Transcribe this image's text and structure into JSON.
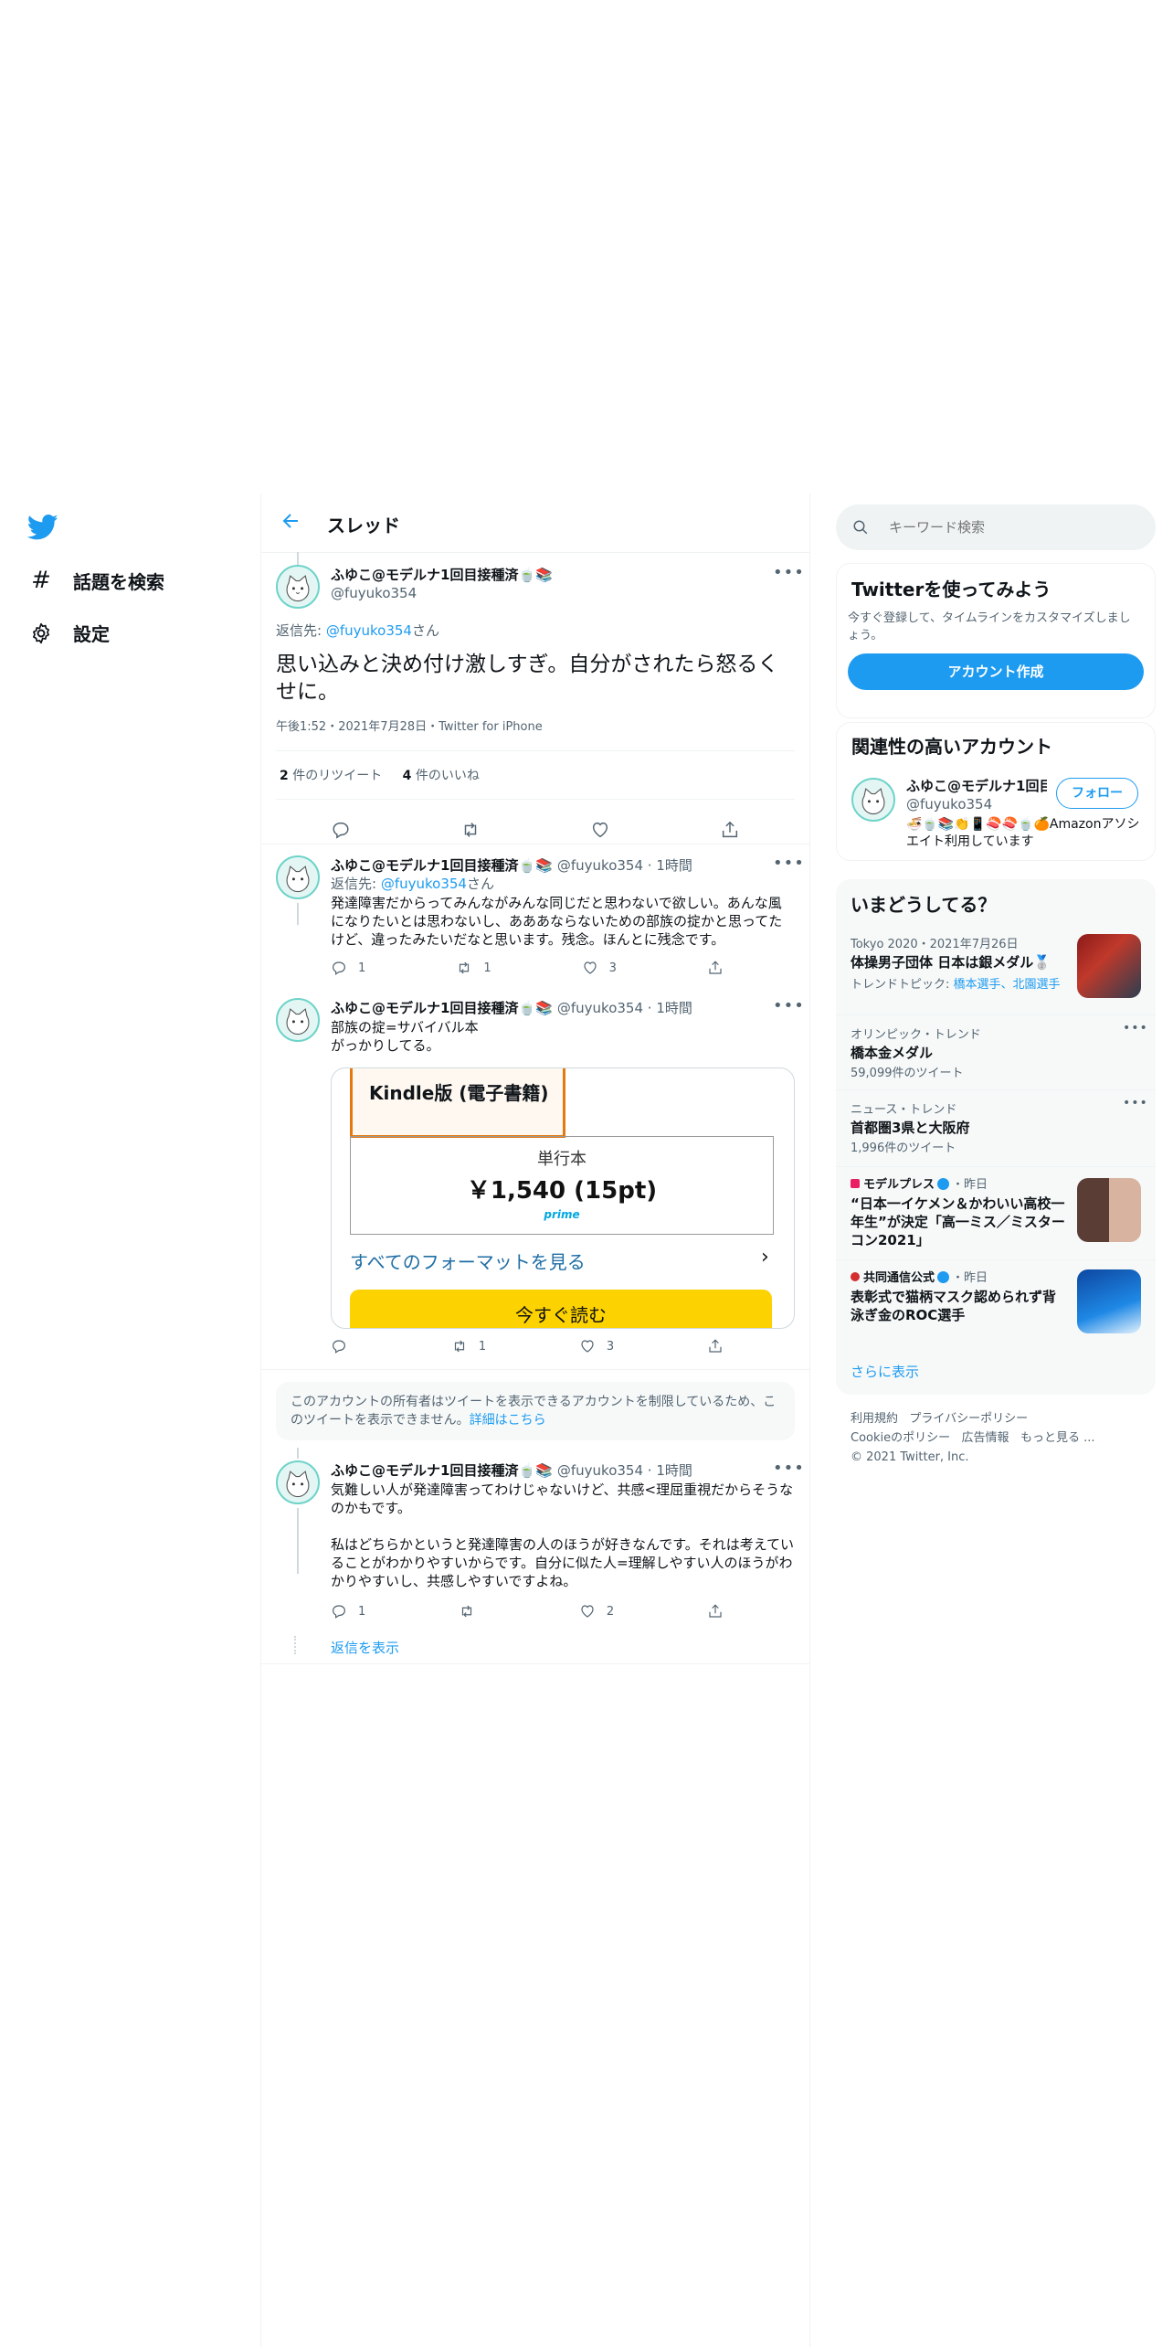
{
  "nav": {
    "explore_label": "話題を検索",
    "settings_label": "設定"
  },
  "header": {
    "title": "スレッド"
  },
  "main_tweet": {
    "name": "ふゆこ@モデルナ1回目接種済🍵📚",
    "handle": "@fuyuko354",
    "reply_prefix": "返信先: ",
    "reply_to": "@fuyuko354",
    "reply_suffix": "さん",
    "text": "思い込みと決め付け激しすぎ。自分がされたら怒るくせに。",
    "time": "午後1:52",
    "date": "2021年7月28日",
    "source": "Twitter for iPhone",
    "retweet_count": "2",
    "retweet_label": "件のリツイート",
    "like_count": "4",
    "like_label": "件のいいね"
  },
  "reply1": {
    "name": "ふゆこ@モデルナ1回目接種済🍵📚",
    "handle": "@fuyuko354",
    "time": "1時間",
    "reply_prefix": "返信先: ",
    "reply_to": "@fuyuko354",
    "reply_suffix": "さん",
    "text": "発達障害だからってみんながみんな同じだと思わないで欲しい。あんな風になりたいとは思わないし、あああならないための部族の掟かと思ってたけど、違ったみたいだなと思います。残念。ほんとに残念です。",
    "replies": "1",
    "retweets": "1",
    "likes": "3"
  },
  "reply2": {
    "name": "ふゆこ@モデルナ1回目接種済🍵📚",
    "handle": "@fuyuko354",
    "time": "1時間",
    "text_line1": "部族の掟=サバイバル本",
    "text_line2": "がっかりしてる。",
    "card": {
      "kindle_label": "Kindle版 (電子書籍)",
      "format": "単行本",
      "price": "￥1,540 (15pt)",
      "prime": "prime",
      "all_formats": "すべてのフォーマットを見る",
      "read_now": "今すぐ読む"
    },
    "replies": "",
    "retweets": "1",
    "likes": "3"
  },
  "restricted": {
    "text": "このアカウントの所有者はツイートを表示できるアカウントを制限しているため、このツイートを表示できません。",
    "link": "詳細はこちら"
  },
  "reply3": {
    "name": "ふゆこ@モデルナ1回目接種済🍵📚",
    "handle": "@fuyuko354",
    "time": "1時間",
    "text_p1": "気難しい人が発達障害ってわけじゃないけど、共感<理屈重視だからそうなのかもです。",
    "text_p2": "私はどちらかというと発達障害の人のほうが好きなんです。それは考えていることがわかりやすいからです。自分に似た人=理解しやすい人のほうがわかりやすいし、共感しやすいですよね。",
    "replies": "1",
    "retweets": "",
    "likes": "2",
    "show_replies": "返信を表示"
  },
  "search": {
    "placeholder": "キーワード検索"
  },
  "signup": {
    "title": "Twitterを使ってみよう",
    "desc": "今すぐ登録して、タイムラインをカスタマイズしましょう。",
    "button": "アカウント作成"
  },
  "related": {
    "title": "関連性の高いアカウント",
    "name": "ふゆこ@モデルナ1回目",
    "handle": "@fuyuko354",
    "follow": "フォロー",
    "bio": "🍜🍵📚👏📱🍣🍣🍵🍊Amazonアソシエイト利用しています"
  },
  "trends": {
    "title": "いまどうしてる？",
    "items": [
      {
        "meta": "Tokyo 2020・2021年7月26日",
        "name": "体操男子団体 日本は銀メダル🥈",
        "sub_prefix": "トレンドトピック: ",
        "sub_links": "橋本選手、北園選手"
      },
      {
        "meta": "オリンピック・トレンド",
        "name": "橋本金メダル",
        "sub": "59,099件のツイート"
      },
      {
        "meta": "ニュース・トレンド",
        "name": "首都圏3県と大阪府",
        "sub": "1,996件のツイート"
      },
      {
        "source": "モデルプレス",
        "time": "・昨日",
        "name": "“日本一イケメン＆かわいい高校一年生”が決定「高一ミス／ミスターコン2021」"
      },
      {
        "source": "共同通信公式",
        "time": "・昨日",
        "name": "表彰式で猫柄マスク認められず背泳ぎ金のROC選手"
      }
    ],
    "show_more": "さらに表示"
  },
  "footer": {
    "links1": [
      "利用規約",
      "プライバシーポリシー"
    ],
    "links2": [
      "Cookieのポリシー",
      "広告情報",
      "もっと見る ..."
    ],
    "copyright": "© 2021 Twitter, Inc."
  },
  "colors": {
    "accent": "#1d9bf0",
    "text": "#0f1419",
    "muted": "#536471",
    "border": "#eff3f4"
  }
}
